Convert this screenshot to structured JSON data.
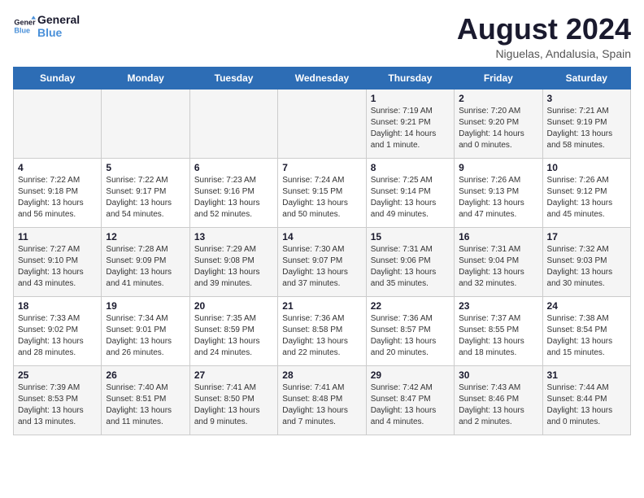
{
  "logo": {
    "line1": "General",
    "line2": "Blue"
  },
  "title": {
    "month_year": "August 2024",
    "location": "Niguelas, Andalusia, Spain"
  },
  "days_of_week": [
    "Sunday",
    "Monday",
    "Tuesday",
    "Wednesday",
    "Thursday",
    "Friday",
    "Saturday"
  ],
  "weeks": [
    [
      {
        "day": "",
        "info": ""
      },
      {
        "day": "",
        "info": ""
      },
      {
        "day": "",
        "info": ""
      },
      {
        "day": "",
        "info": ""
      },
      {
        "day": "1",
        "info": "Sunrise: 7:19 AM\nSunset: 9:21 PM\nDaylight: 14 hours\nand 1 minute."
      },
      {
        "day": "2",
        "info": "Sunrise: 7:20 AM\nSunset: 9:20 PM\nDaylight: 14 hours\nand 0 minutes."
      },
      {
        "day": "3",
        "info": "Sunrise: 7:21 AM\nSunset: 9:19 PM\nDaylight: 13 hours\nand 58 minutes."
      }
    ],
    [
      {
        "day": "4",
        "info": "Sunrise: 7:22 AM\nSunset: 9:18 PM\nDaylight: 13 hours\nand 56 minutes."
      },
      {
        "day": "5",
        "info": "Sunrise: 7:22 AM\nSunset: 9:17 PM\nDaylight: 13 hours\nand 54 minutes."
      },
      {
        "day": "6",
        "info": "Sunrise: 7:23 AM\nSunset: 9:16 PM\nDaylight: 13 hours\nand 52 minutes."
      },
      {
        "day": "7",
        "info": "Sunrise: 7:24 AM\nSunset: 9:15 PM\nDaylight: 13 hours\nand 50 minutes."
      },
      {
        "day": "8",
        "info": "Sunrise: 7:25 AM\nSunset: 9:14 PM\nDaylight: 13 hours\nand 49 minutes."
      },
      {
        "day": "9",
        "info": "Sunrise: 7:26 AM\nSunset: 9:13 PM\nDaylight: 13 hours\nand 47 minutes."
      },
      {
        "day": "10",
        "info": "Sunrise: 7:26 AM\nSunset: 9:12 PM\nDaylight: 13 hours\nand 45 minutes."
      }
    ],
    [
      {
        "day": "11",
        "info": "Sunrise: 7:27 AM\nSunset: 9:10 PM\nDaylight: 13 hours\nand 43 minutes."
      },
      {
        "day": "12",
        "info": "Sunrise: 7:28 AM\nSunset: 9:09 PM\nDaylight: 13 hours\nand 41 minutes."
      },
      {
        "day": "13",
        "info": "Sunrise: 7:29 AM\nSunset: 9:08 PM\nDaylight: 13 hours\nand 39 minutes."
      },
      {
        "day": "14",
        "info": "Sunrise: 7:30 AM\nSunset: 9:07 PM\nDaylight: 13 hours\nand 37 minutes."
      },
      {
        "day": "15",
        "info": "Sunrise: 7:31 AM\nSunset: 9:06 PM\nDaylight: 13 hours\nand 35 minutes."
      },
      {
        "day": "16",
        "info": "Sunrise: 7:31 AM\nSunset: 9:04 PM\nDaylight: 13 hours\nand 32 minutes."
      },
      {
        "day": "17",
        "info": "Sunrise: 7:32 AM\nSunset: 9:03 PM\nDaylight: 13 hours\nand 30 minutes."
      }
    ],
    [
      {
        "day": "18",
        "info": "Sunrise: 7:33 AM\nSunset: 9:02 PM\nDaylight: 13 hours\nand 28 minutes."
      },
      {
        "day": "19",
        "info": "Sunrise: 7:34 AM\nSunset: 9:01 PM\nDaylight: 13 hours\nand 26 minutes."
      },
      {
        "day": "20",
        "info": "Sunrise: 7:35 AM\nSunset: 8:59 PM\nDaylight: 13 hours\nand 24 minutes."
      },
      {
        "day": "21",
        "info": "Sunrise: 7:36 AM\nSunset: 8:58 PM\nDaylight: 13 hours\nand 22 minutes."
      },
      {
        "day": "22",
        "info": "Sunrise: 7:36 AM\nSunset: 8:57 PM\nDaylight: 13 hours\nand 20 minutes."
      },
      {
        "day": "23",
        "info": "Sunrise: 7:37 AM\nSunset: 8:55 PM\nDaylight: 13 hours\nand 18 minutes."
      },
      {
        "day": "24",
        "info": "Sunrise: 7:38 AM\nSunset: 8:54 PM\nDaylight: 13 hours\nand 15 minutes."
      }
    ],
    [
      {
        "day": "25",
        "info": "Sunrise: 7:39 AM\nSunset: 8:53 PM\nDaylight: 13 hours\nand 13 minutes."
      },
      {
        "day": "26",
        "info": "Sunrise: 7:40 AM\nSunset: 8:51 PM\nDaylight: 13 hours\nand 11 minutes."
      },
      {
        "day": "27",
        "info": "Sunrise: 7:41 AM\nSunset: 8:50 PM\nDaylight: 13 hours\nand 9 minutes."
      },
      {
        "day": "28",
        "info": "Sunrise: 7:41 AM\nSunset: 8:48 PM\nDaylight: 13 hours\nand 7 minutes."
      },
      {
        "day": "29",
        "info": "Sunrise: 7:42 AM\nSunset: 8:47 PM\nDaylight: 13 hours\nand 4 minutes."
      },
      {
        "day": "30",
        "info": "Sunrise: 7:43 AM\nSunset: 8:46 PM\nDaylight: 13 hours\nand 2 minutes."
      },
      {
        "day": "31",
        "info": "Sunrise: 7:44 AM\nSunset: 8:44 PM\nDaylight: 13 hours\nand 0 minutes."
      }
    ]
  ]
}
